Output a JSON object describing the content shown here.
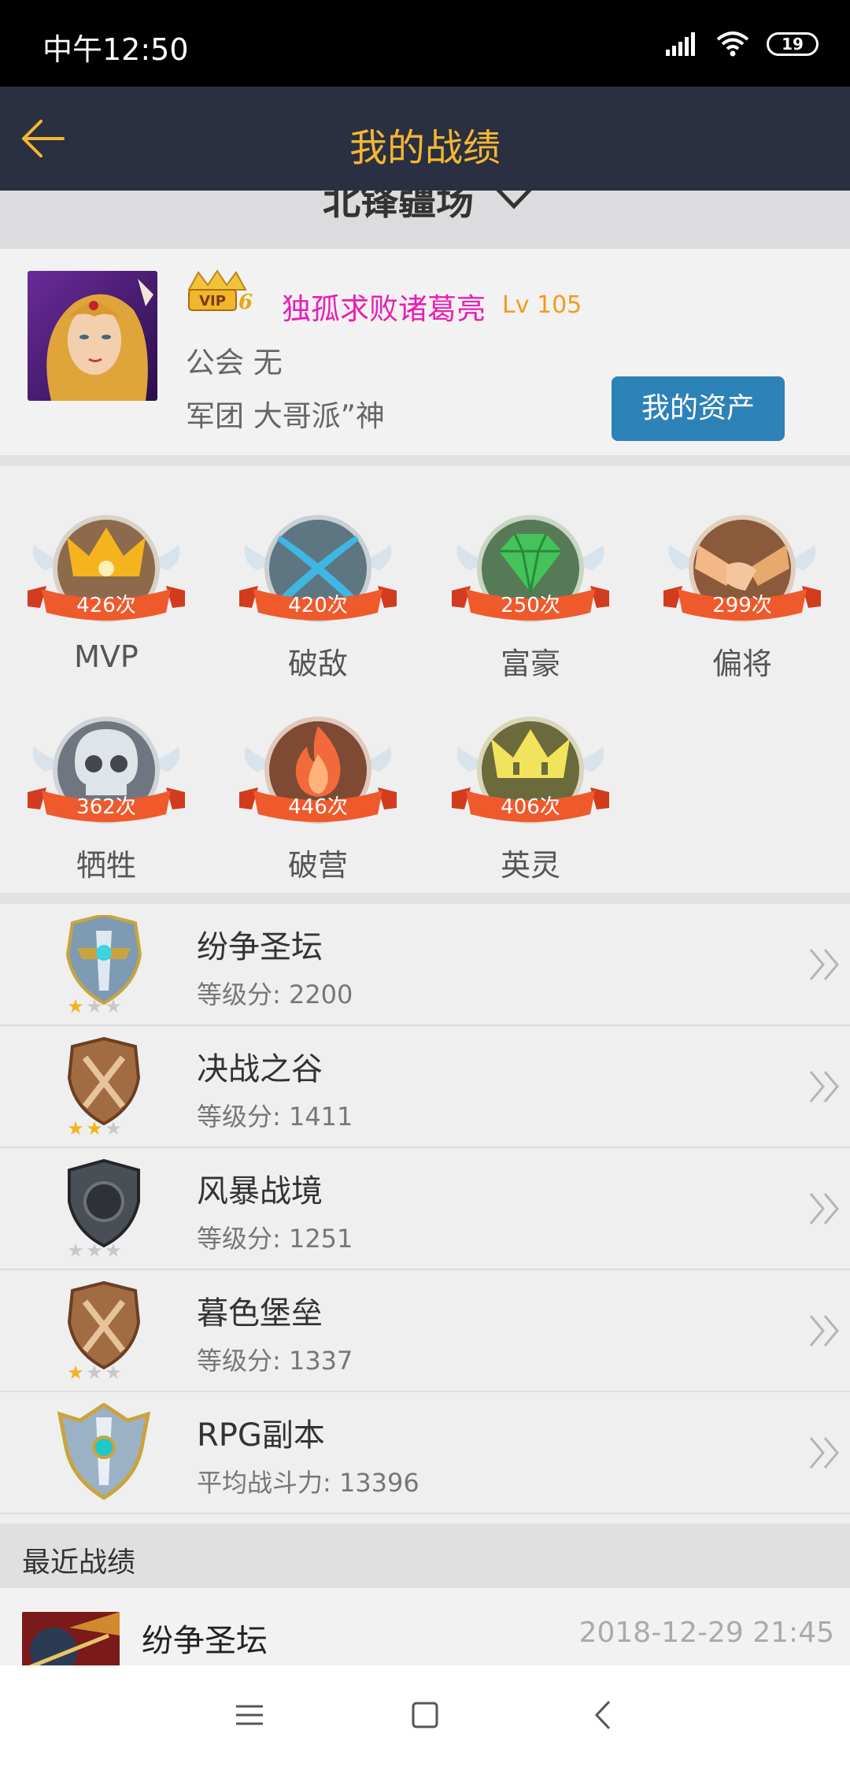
{
  "status_bar": {
    "time": "中午12:50",
    "battery": "19"
  },
  "app_bar": {
    "title": "我的战绩"
  },
  "server": {
    "name": "北锋疆场"
  },
  "profile": {
    "vip_text": "VIP6",
    "name": "独孤求败诸葛亮",
    "level": "Lv 105",
    "guild": "公会  无",
    "legion": "军团  大哥派”神",
    "asset_button": "我的资产"
  },
  "badges": [
    {
      "count": "426次",
      "label": "MVP",
      "icon": "crown-icon",
      "color": "#f5b41e"
    },
    {
      "count": "420次",
      "label": "破敌",
      "icon": "crossed-swords-icon",
      "color": "#3fb7e3"
    },
    {
      "count": "250次",
      "label": "富豪",
      "icon": "diamond-icon",
      "color": "#45c25a"
    },
    {
      "count": "299次",
      "label": "偏将",
      "icon": "handshake-icon",
      "color": "#e8a96c"
    },
    {
      "count": "362次",
      "label": "牺牲",
      "icon": "skull-icon",
      "color": "#c8ccd0"
    },
    {
      "count": "446次",
      "label": "破营",
      "icon": "flame-icon",
      "color": "#f26a3b"
    },
    {
      "count": "406次",
      "label": "英灵",
      "icon": "ghost-crown-icon",
      "color": "#f1e35b"
    }
  ],
  "modes": [
    {
      "name": "纷争圣坛",
      "score": "等级分: 2200"
    },
    {
      "name": "决战之谷",
      "score": "等级分: 1411"
    },
    {
      "name": "风暴战境",
      "score": "等级分: 1251"
    },
    {
      "name": "暮色堡垒",
      "score": "等级分: 1337"
    },
    {
      "name": "RPG副本",
      "score": "平均战斗力: 13396"
    }
  ],
  "recent": {
    "title": "最近战绩",
    "items": [
      {
        "mode": "纷争圣坛",
        "time": "2018-12-29 21:45"
      }
    ]
  },
  "colors": {
    "app_bar": "#2a3042",
    "title": "#f4b731",
    "button": "#2d82b8",
    "player_name": "#e81fb4",
    "level": "#f49b1a"
  }
}
